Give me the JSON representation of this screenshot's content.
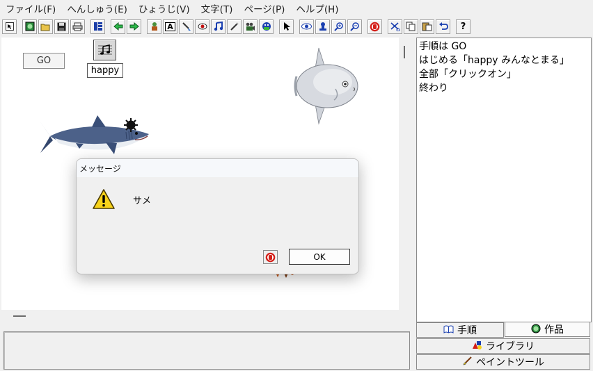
{
  "menu": [
    {
      "label": "ファイル(F)"
    },
    {
      "label": "へんしゅう(E)"
    },
    {
      "label": "ひょうじ(V)"
    },
    {
      "label": "文字(T)"
    },
    {
      "label": "ページ(P)"
    },
    {
      "label": "ヘルプ(H)"
    }
  ],
  "toolbar": {
    "text_tool_glyph": "A",
    "help_glyph": "?"
  },
  "stage": {
    "go_button_label": "GO",
    "music_label": "happy"
  },
  "dialog": {
    "title": "メッセージ",
    "message": "サメ",
    "ok_label": "OK"
  },
  "script_panel": {
    "lines": [
      "手順は  GO",
      "はじめる「happy  みんなとまる」",
      "全部「クリックオン」",
      "終わり"
    ]
  },
  "tabs": {
    "procedure": "手順",
    "work": "作品"
  },
  "side_buttons": {
    "library": "ライブラリ",
    "paint_tool": "ペイントツール"
  },
  "colors": {
    "window_bg": "#f0f0f0",
    "stage_bg": "#ffffff",
    "warning_yellow": "#f7d21a",
    "stop_red": "#d4201a"
  }
}
